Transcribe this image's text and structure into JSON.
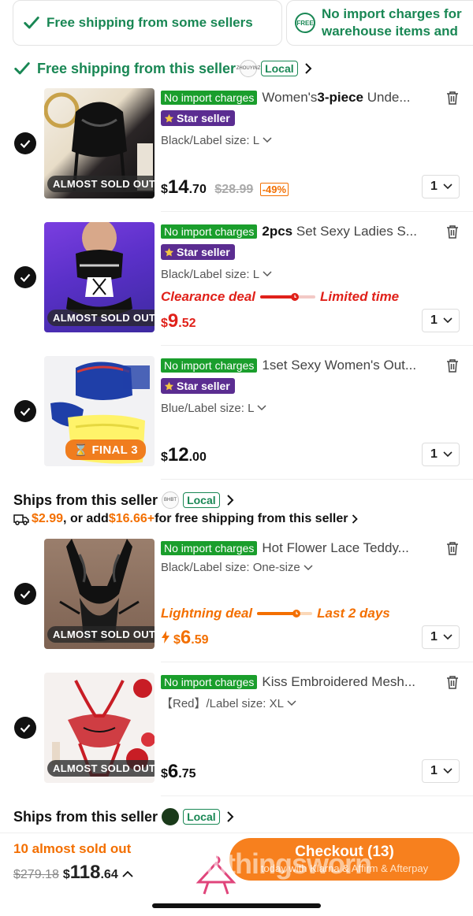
{
  "chips": {
    "chip1": "Free shipping from some sellers",
    "chip2_badge": "FREE",
    "chip2": "No import charges for warehouse items and"
  },
  "sellers": [
    {
      "label": "Free shipping from this seller",
      "logo": "ZHOUYINZ",
      "tag": "Local"
    },
    {
      "label": "Ships from this seller",
      "logo": "BHBT",
      "tag": "Local"
    },
    {
      "label": "Ships from this seller",
      "logo": "",
      "tag": "Local"
    }
  ],
  "shipping_notice": {
    "fee": "$2.99",
    "mid": ", or add ",
    "threshold": "$16.66+",
    "tail": " for free shipping from this seller"
  },
  "items": [
    {
      "badge": "No import charges",
      "title_pre": "Women's",
      "title_bold": "3-piece",
      "title_post": " Unde...",
      "star_seller": "Star seller",
      "variant": "Black/Label size: L",
      "thumb_badge": "ALMOST SOLD OUT",
      "price_cur": "$",
      "price_int": "14",
      "price_dec": ".70",
      "orig_price": "$28.99",
      "discount": "-49%",
      "qty": "1"
    },
    {
      "badge": "No import charges",
      "title_pre": "",
      "title_bold": "2pcs",
      "title_post": " Set Sexy Ladies S...",
      "star_seller": "Star seller",
      "variant": "Black/Label size: L",
      "thumb_badge": "ALMOST SOLD OUT",
      "deal_left": "Clearance deal",
      "deal_right": "Limited time",
      "price_cur": "$",
      "price_int": "9",
      "price_dec": ".52",
      "qty": "1"
    },
    {
      "badge": "No import charges",
      "title_pre": "1set Sexy Women's Out...",
      "title_bold": "",
      "title_post": "",
      "star_seller": "Star seller",
      "variant": "Blue/Label size: L",
      "thumb_badge": "FINAL 3",
      "price_cur": "$",
      "price_int": "12",
      "price_dec": ".00",
      "qty": "1"
    },
    {
      "badge": "No import charges",
      "title_pre": "Hot Flower Lace Teddy...",
      "title_bold": "",
      "title_post": "",
      "variant": "Black/Label size: One-size",
      "thumb_badge": "ALMOST SOLD OUT",
      "deal_left": "Lightning deal",
      "deal_right": "Last 2 days",
      "price_cur": "$",
      "price_int": "6",
      "price_dec": ".59",
      "qty": "1"
    },
    {
      "badge": "No import charges",
      "title_pre": "Kiss Embroidered Mesh...",
      "title_bold": "",
      "title_post": "",
      "variant": "【Red】/Label size: XL",
      "thumb_badge": "ALMOST SOLD OUT",
      "price_cur": "$",
      "price_int": "6",
      "price_dec": ".75",
      "qty": "1"
    }
  ],
  "bottom": {
    "sold_out": "10 almost sold out",
    "old_total": "$279.18",
    "total_cur": "$",
    "total_int": "118",
    "total_dec": ".64",
    "checkout": "Checkout (13)",
    "checkout_sub": "today with Klarna & Affirm & Afterpay",
    "watermark": "allthingsworn"
  },
  "colors": {
    "green": "#198754",
    "badge_green": "#1a9e2c",
    "star_purple": "#5b2d91",
    "deal_red": "#e0211a",
    "accent_orange": "#f36f00",
    "checkout_orange": "#f7801e"
  }
}
